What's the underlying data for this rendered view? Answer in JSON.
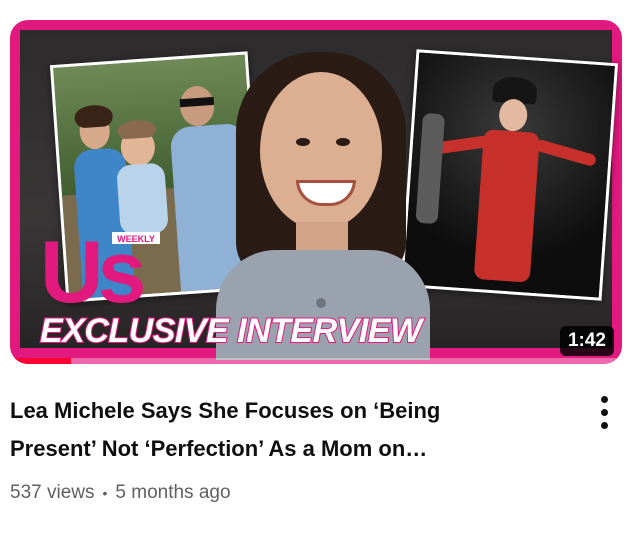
{
  "video": {
    "title_line1": "Lea Michele Says She Focuses on ‘Being",
    "title_line2": "Present’ Not ‘Perfection’ As a Mom on…",
    "views": "537 views",
    "separator": "•",
    "age": "5 months ago",
    "duration": "1:42",
    "watch_progress_percent": 10
  },
  "thumbnail": {
    "brand_logo_text": "Us",
    "brand_logo_badge": "WEEKLY",
    "overlay_text": "EXCLUSIVE INTERVIEW",
    "frame_color": "#e2197f"
  },
  "icons": {
    "menu": "more-vert-icon"
  },
  "colors": {
    "title": "#0f0f0f",
    "meta": "#606060",
    "progress": "#ff0033"
  }
}
